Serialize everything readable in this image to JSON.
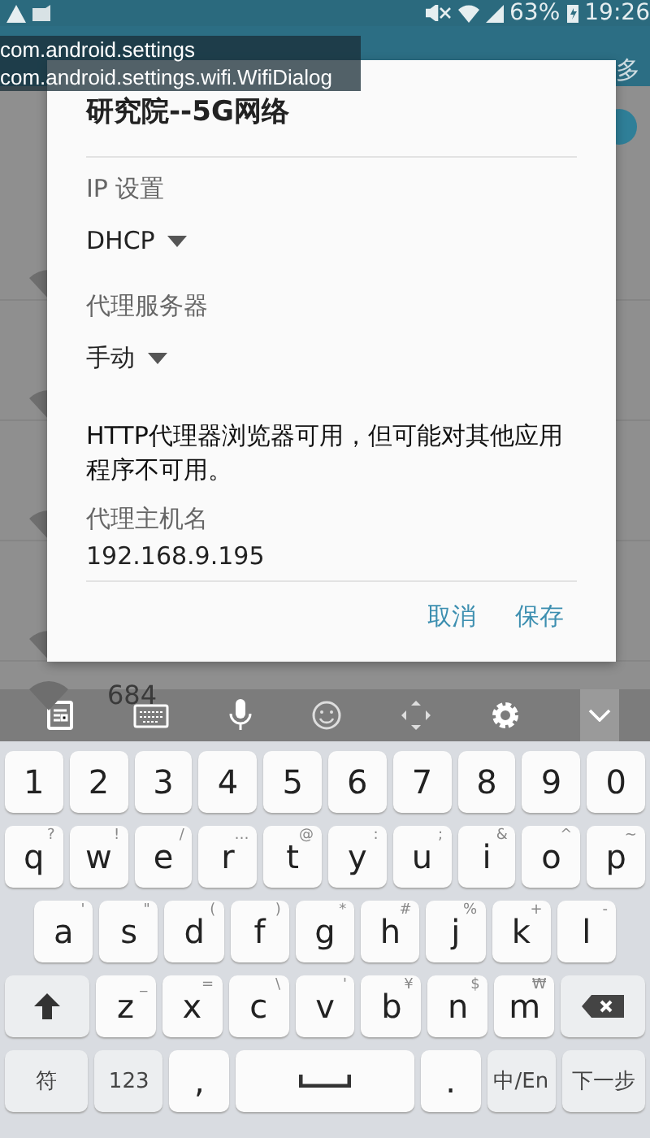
{
  "status_bar": {
    "battery": "63%",
    "time": "19:26"
  },
  "debug_overlay": [
    "com.android.settings",
    "com.android.settings.wifi.WifiDialog"
  ],
  "background": {
    "menu_label": "多",
    "networks": [
      {
        "name": "684"
      }
    ]
  },
  "dialog": {
    "title": "研究院--5G网络",
    "fields": [
      {
        "kind": "spinner",
        "label": "IP 设置",
        "value": "DHCP"
      },
      {
        "kind": "spinner",
        "label": "代理服务器",
        "value": "手动"
      },
      {
        "kind": "note",
        "text": "HTTP代理器浏览器可用，但可能对其他应用程序不可用。"
      },
      {
        "kind": "input",
        "label": "代理主机名",
        "value": "192.168.9.195"
      }
    ],
    "buttons": [
      "取消",
      "保存"
    ]
  },
  "keyboard": {
    "rows": [
      [
        {
          "main": "1"
        },
        {
          "main": "2"
        },
        {
          "main": "3"
        },
        {
          "main": "4"
        },
        {
          "main": "5"
        },
        {
          "main": "6"
        },
        {
          "main": "7"
        },
        {
          "main": "8"
        },
        {
          "main": "9"
        },
        {
          "main": "0"
        }
      ],
      [
        {
          "main": "q",
          "hint": "?"
        },
        {
          "main": "w",
          "hint": "!"
        },
        {
          "main": "e",
          "hint": "/"
        },
        {
          "main": "r",
          "hint": "…"
        },
        {
          "main": "t",
          "hint": "@"
        },
        {
          "main": "y",
          "hint": ":"
        },
        {
          "main": "u",
          "hint": ";"
        },
        {
          "main": "i",
          "hint": "&"
        },
        {
          "main": "o",
          "hint": "^"
        },
        {
          "main": "p",
          "hint": "~"
        }
      ],
      [
        {
          "main": "a",
          "hint": "'"
        },
        {
          "main": "s",
          "hint": "\""
        },
        {
          "main": "d",
          "hint": "("
        },
        {
          "main": "f",
          "hint": ")"
        },
        {
          "main": "g",
          "hint": "*"
        },
        {
          "main": "h",
          "hint": "#"
        },
        {
          "main": "j",
          "hint": "%"
        },
        {
          "main": "k",
          "hint": "+"
        },
        {
          "main": "l",
          "hint": "-"
        }
      ],
      [
        {
          "kind": "shift"
        },
        {
          "main": "z",
          "hint": "_"
        },
        {
          "main": "x",
          "hint": "="
        },
        {
          "main": "c",
          "hint": "\\"
        },
        {
          "main": "v",
          "hint": "'"
        },
        {
          "main": "b",
          "hint": "¥"
        },
        {
          "main": "n",
          "hint": "$"
        },
        {
          "main": "m",
          "hint": "₩"
        },
        {
          "kind": "delete"
        }
      ]
    ],
    "bottom_row": [
      {
        "kind": "wide",
        "main": "符"
      },
      {
        "kind": "mid",
        "main": "123"
      },
      {
        "main": ","
      },
      {
        "kind": "space"
      },
      {
        "main": "."
      },
      {
        "kind": "mid",
        "main": "中/En"
      },
      {
        "kind": "wide",
        "main": "下一步"
      }
    ]
  }
}
